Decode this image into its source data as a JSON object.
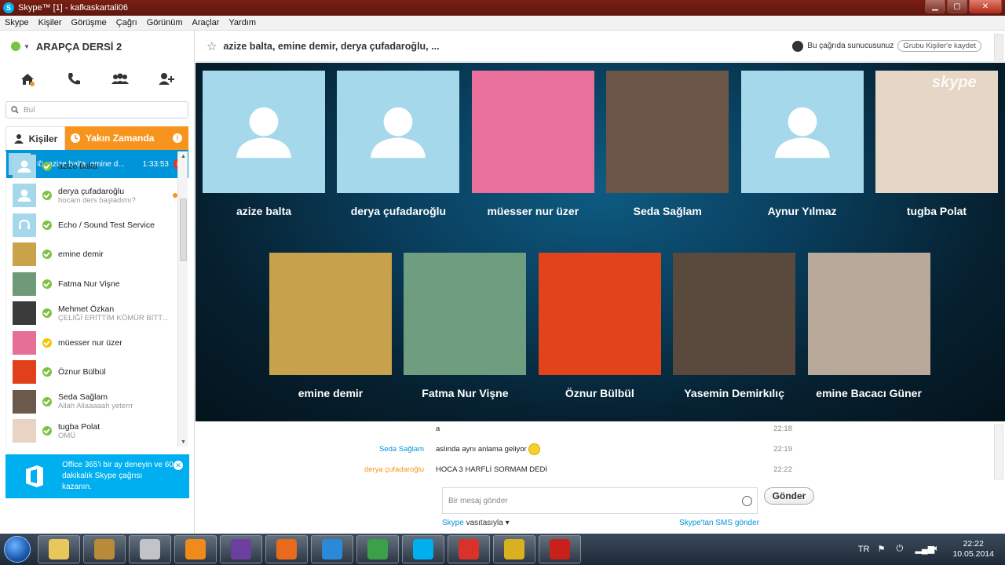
{
  "window": {
    "title": "Skype™ [1] - kafkaskartali06"
  },
  "menu": [
    "Skype",
    "Kişiler",
    "Görüşme",
    "Çağrı",
    "Görünüm",
    "Araçlar",
    "Yardım"
  ],
  "profile": {
    "name": "ARAPÇA DERSİ 2"
  },
  "search": {
    "placeholder": "Bul"
  },
  "tabs": {
    "contacts": "Kişiler",
    "recent": "Yakın Zamanda"
  },
  "active_call": {
    "name": "azize balta, emine d...",
    "duration": "1:33:53"
  },
  "contacts": [
    {
      "name": "azize balta",
      "mood": "",
      "avatar": "placeholder",
      "presence": "#7cc142"
    },
    {
      "name": "derya çufadaroğlu",
      "mood": "hocam ders başladımı?",
      "avatar": "placeholder",
      "presence": "#7cc142",
      "unread": true
    },
    {
      "name": "Echo / Sound Test Service",
      "mood": "",
      "avatar": "headset",
      "presence": "#7cc142"
    },
    {
      "name": "emine demir",
      "mood": "",
      "avatar": "#c9a24a",
      "presence": "#7cc142"
    },
    {
      "name": "Fatma Nur Vişne",
      "mood": "",
      "avatar": "#6f9a7a",
      "presence": "#7cc142"
    },
    {
      "name": "Mehmet Özkan",
      "mood": "ÇELİĞİ ERİTTİM KÖMÜR BİTT...",
      "avatar": "#3b3b3b",
      "presence": "#7cc142"
    },
    {
      "name": "müesser nur üzer",
      "mood": "",
      "avatar": "#e66f98",
      "presence": "#f2c500"
    },
    {
      "name": "Öznur Bülbül",
      "mood": "",
      "avatar": "#e2401c",
      "presence": "#7cc142"
    },
    {
      "name": "Seda Sağlam",
      "mood": "Allah Allaaaaah yeterrr",
      "avatar": "#6b5a4c",
      "presence": "#7cc142"
    },
    {
      "name": "tugba Polat",
      "mood": "OMÜ",
      "avatar": "#e8d3c4",
      "presence": "#7cc142"
    }
  ],
  "promo": {
    "text": "Office 365'i bir ay deneyin ve 60 dakikalık Skype çağrısı kazanın."
  },
  "conversation": {
    "title": "azize balta, emine demir, derya çufadaroğlu, ...",
    "presenter": "Bu çağrıda sunucusunuz",
    "save_label": "Grubu Kişiler'e kaydet"
  },
  "participants_row1": [
    {
      "name": "azize balta",
      "tile": "placeholder"
    },
    {
      "name": "derya çufadaroğlu",
      "tile": "placeholder"
    },
    {
      "name": "müesser nur üzer",
      "tile": "#e8709a"
    },
    {
      "name": "Seda Sağlam",
      "tile": "#6a5546"
    },
    {
      "name": "Aynur Yılmaz",
      "tile": "placeholder"
    },
    {
      "name": "tugba Polat",
      "tile": "#e6d6c6"
    }
  ],
  "participants_row2": [
    {
      "name": "emine demir",
      "tile": "#c7a14c"
    },
    {
      "name": "Fatma Nur Vişne",
      "tile": "#6e9d80"
    },
    {
      "name": "Öznur Bülbül",
      "tile": "#e2431b"
    },
    {
      "name": "Yasemin Demirkılıç",
      "tile": "#5a4a3e"
    },
    {
      "name": "emine Bacacı Güner",
      "tile": "#b9a99a"
    }
  ],
  "messages": [
    {
      "sender": "",
      "text": "a",
      "time": "22:18",
      "color": "#0094d9"
    },
    {
      "sender": "Seda Sağlam",
      "text": "aslında aynı anlama geliyor",
      "time": "22:19",
      "color": "#0094d9",
      "emoji": true
    },
    {
      "sender": "derya çufadaroğlu",
      "text": "HOCA 3 HARFLİ SORMAM DEDİ",
      "time": "22:22",
      "color": "#f7941d"
    }
  ],
  "compose": {
    "placeholder": "Bir mesaj gönder",
    "send_label": "Gönder",
    "via_brand": "Skype",
    "via_text": " vasıtasıyla ▾",
    "sms_link": "Skype'tan SMS gönder"
  },
  "taskbar": {
    "apps": [
      {
        "name": "explorer",
        "color": "#e8c85a"
      },
      {
        "name": "winamp",
        "color": "#b88a3a"
      },
      {
        "name": "bluetooth",
        "color": "#c0c4c8"
      },
      {
        "name": "media-player",
        "color": "#f08a1c"
      },
      {
        "name": "visual-studio",
        "color": "#6a3fa0"
      },
      {
        "name": "firefox",
        "color": "#e86a1c"
      },
      {
        "name": "internet-explorer",
        "color": "#2a8ad8"
      },
      {
        "name": "chrome",
        "color": "#3aa04a"
      },
      {
        "name": "skype",
        "color": "#00aff0"
      },
      {
        "name": "ccleaner",
        "color": "#d8322a"
      },
      {
        "name": "audio-app",
        "color": "#d8b020"
      },
      {
        "name": "adobe-reader",
        "color": "#c8201a"
      }
    ],
    "lang": "TR",
    "time": "22:22",
    "date": "10.05.2014"
  }
}
